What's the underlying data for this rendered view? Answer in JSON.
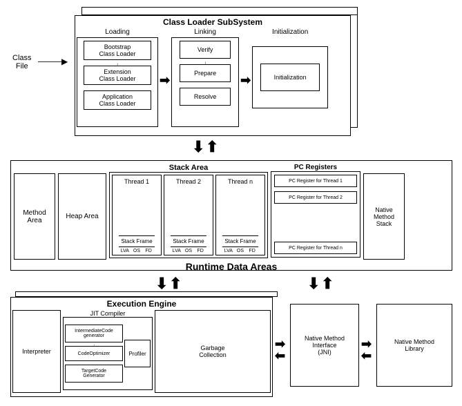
{
  "input": "Class\nFile",
  "classLoader": {
    "title": "Class Loader SubSystem",
    "loading": {
      "title": "Loading",
      "bootstrap": "Bootstrap\nClass Loader",
      "extension": "Extension\nClass Loader",
      "application": "Application\nClass Loader"
    },
    "linking": {
      "title": "Linking",
      "verify": "Verify",
      "prepare": "Prepare",
      "resolve": "Resolve"
    },
    "init": {
      "title": "Initialization",
      "box": "Initialization"
    }
  },
  "runtime": {
    "title": "Runtime Data Areas",
    "methodArea": "Method\nArea",
    "heapArea": "Heap Area",
    "stackArea": {
      "title": "Stack Area",
      "thread1": "Thread 1",
      "thread2": "Thread 2",
      "threadN": "Thread n",
      "stackFrame": "Stack Frame",
      "lva": "LVA",
      "os": "OS",
      "fd": "FD"
    },
    "pcRegisters": {
      "title": "PC Registers",
      "r1": "PC Register for Thread 1",
      "r2": "PC Register for Thread 2",
      "rn": "PC Register for Thread n"
    },
    "nativeStack": "Native\nMethod\nStack"
  },
  "execution": {
    "title": "Execution Engine",
    "interpreter": "Interpreter",
    "jit": {
      "title": "JIT Compiler",
      "intermediate": "IntermediateCode\ngenerator",
      "optimizer": "CodeOptimizer",
      "target": "TargetCode\nGenerator"
    },
    "profiler": "Profiler",
    "gc": "Garbage\nCollection"
  },
  "jni": "Native Method\nInterface\n(JNI)",
  "nativeLib": "Native Method\nLibrary"
}
